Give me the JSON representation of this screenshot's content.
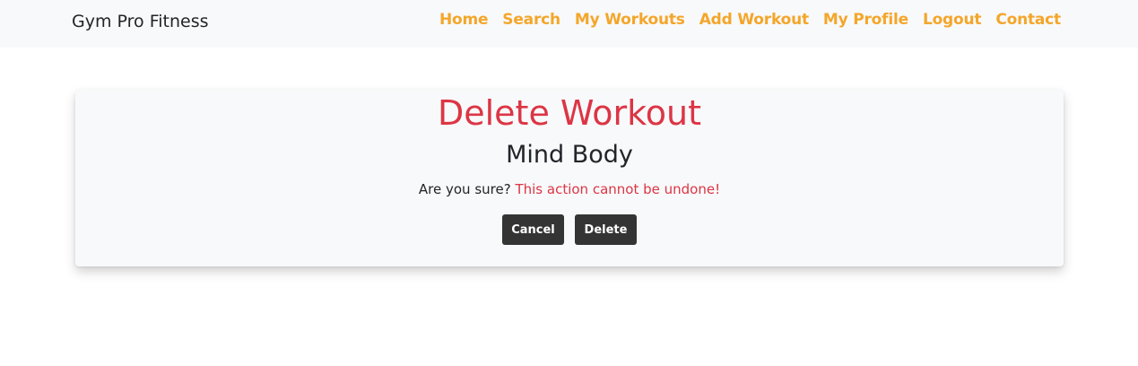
{
  "navbar": {
    "brand": "Gym Pro Fitness",
    "links": [
      {
        "label": "Home"
      },
      {
        "label": "Search"
      },
      {
        "label": "My Workouts"
      },
      {
        "label": "Add Workout"
      },
      {
        "label": "My Profile"
      },
      {
        "label": "Logout"
      },
      {
        "label": "Contact"
      }
    ],
    "link_color": "#f4a62a"
  },
  "card": {
    "title": "Delete Workout",
    "workout_name": "Mind Body",
    "question": "Are you sure?",
    "warning": "This action cannot be undone!",
    "cancel_label": "Cancel",
    "delete_label": "Delete",
    "title_color": "#dc3545"
  }
}
